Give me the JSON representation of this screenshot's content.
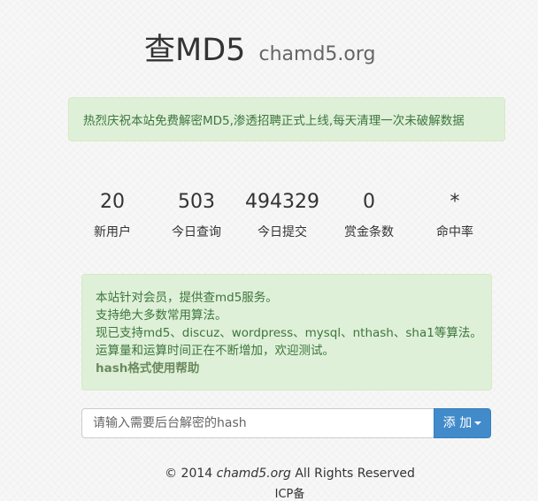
{
  "header": {
    "brand": "查MD5",
    "domain": "chamd5.org"
  },
  "announcement": "热烈庆祝本站免费解密MD5,渗透招聘正式上线,每天清理一次未破解数据",
  "stats": [
    {
      "value": "20",
      "label": "新用户"
    },
    {
      "value": "503",
      "label": "今日查询"
    },
    {
      "value": "494329",
      "label": "今日提交"
    },
    {
      "value": "0",
      "label": "赏金条数"
    },
    {
      "value": "*",
      "label": "命中率"
    }
  ],
  "info": {
    "line1": "本站针对会员，提供查md5服务。",
    "line2": "支持绝大多数常用算法。",
    "line3": "现已支持md5、discuz、wordpress、mysql、nthash、sha1等算法。",
    "line4": "运算量和运算时间正在不断增加，欢迎测试。",
    "help_link": "hash格式使用帮助"
  },
  "search": {
    "placeholder": "请输入需要后台解密的hash",
    "value": "",
    "add_label": "添 加"
  },
  "footer": {
    "copyright_prefix": "© 2014 ",
    "site": "chamd5.org",
    "copyright_suffix": " All Rights Reserved",
    "icp": "ICP备"
  }
}
